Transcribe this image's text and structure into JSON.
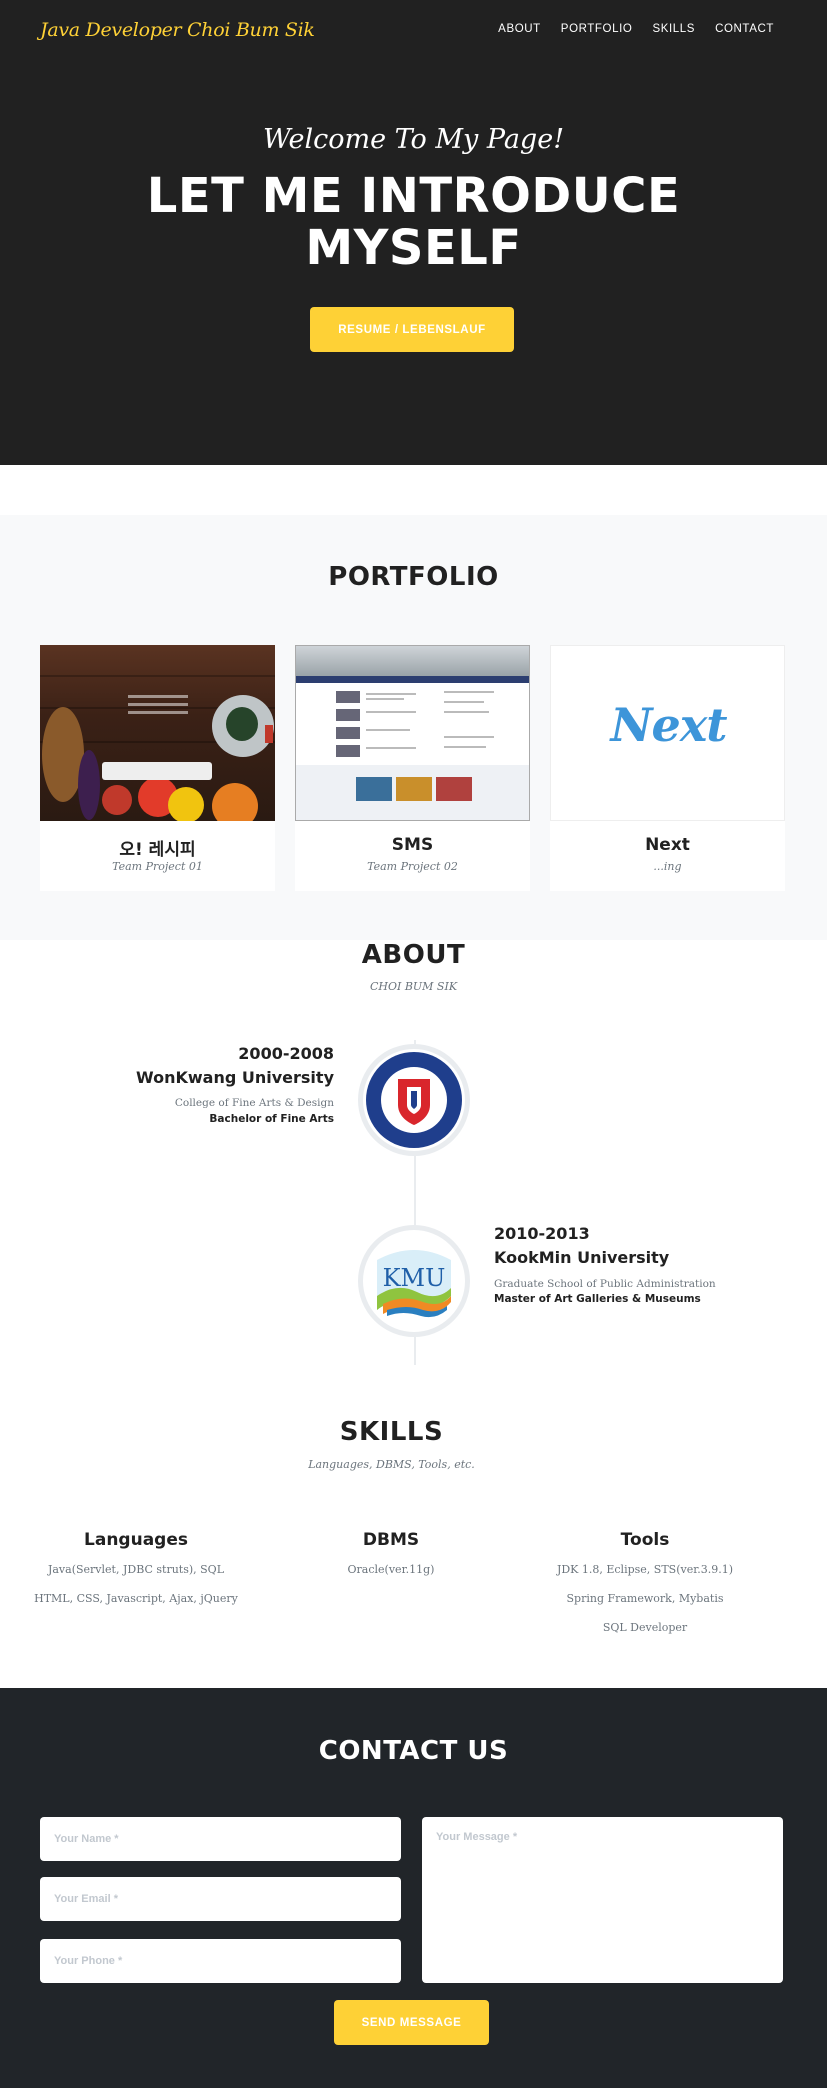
{
  "nav": {
    "brand": "Java Developer Choi Bum Sik",
    "links": [
      "ABOUT",
      "PORTFOLIO",
      "SKILLS",
      "CONTACT"
    ]
  },
  "hero": {
    "subheading": "Welcome To My Page!",
    "heading_line1": "LET ME INTRODUCE",
    "heading_line2": "MYSELF",
    "button": "RESUME / LEBENSLAUF"
  },
  "portfolio": {
    "title": "PORTFOLIO",
    "items": [
      {
        "name": "오! 레시피",
        "caption": "Team Project 01"
      },
      {
        "name": "SMS",
        "caption": "Team Project 02"
      },
      {
        "name": "Next",
        "caption": "...ing",
        "thumb_text": "Next"
      }
    ]
  },
  "about": {
    "title": "ABOUT",
    "subtitle": "CHOI BUM SIK",
    "timeline": [
      {
        "years": "2000-2008",
        "school": "WonKwang University",
        "department": "College of Fine Arts & Design",
        "degree": "Bachelor of Fine Arts",
        "logo_name": "wonkwang-university-logo"
      },
      {
        "years": "2010-2013",
        "school": "KookMin University",
        "department": "Graduate School of Public Administration",
        "degree": "Master of Art Galleries & Museums",
        "logo_text": "KMU",
        "logo_name": "kookmin-university-logo"
      }
    ]
  },
  "skills": {
    "title": "SKILLS",
    "subtitle": "Languages, DBMS, Tools, etc.",
    "columns": [
      {
        "heading": "Languages",
        "items": [
          "Java(Servlet, JDBC struts), SQL",
          "HTML, CSS, Javascript, Ajax, jQuery"
        ]
      },
      {
        "heading": "DBMS",
        "items": [
          "Oracle(ver.11g)"
        ]
      },
      {
        "heading": "Tools",
        "items": [
          "JDK 1.8, Eclipse, STS(ver.3.9.1)",
          "Spring Framework, Mybatis",
          "SQL Developer"
        ]
      }
    ]
  },
  "contact": {
    "title": "CONTACT US",
    "name_placeholder": "Your Name *",
    "email_placeholder": "Your Email *",
    "phone_placeholder": "Your Phone *",
    "message_placeholder": "Your Message *",
    "button": "SEND MESSAGE"
  },
  "colors": {
    "accent": "#fed136",
    "dark": "#212121",
    "contact_bg": "#212529",
    "next_blue": "#3d95d9"
  }
}
